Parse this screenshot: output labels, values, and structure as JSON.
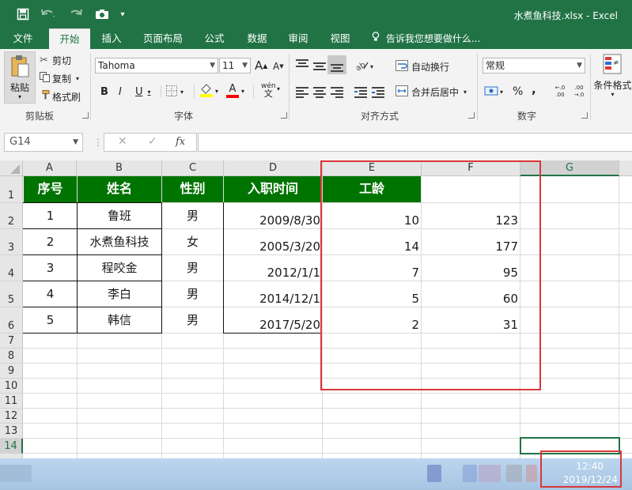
{
  "window": {
    "title": "水煮鱼科技.xlsx - Excel"
  },
  "tabs": [
    "文件",
    "开始",
    "插入",
    "页面布局",
    "公式",
    "数据",
    "审阅",
    "视图"
  ],
  "tell_me": "告诉我您想要做什么...",
  "ribbon": {
    "clipboard": {
      "paste": "粘贴",
      "cut": "剪切",
      "copy": "复制",
      "format_painter": "格式刷",
      "label": "剪贴板"
    },
    "font": {
      "name": "Tahoma",
      "size": "11",
      "bold": "B",
      "italic": "I",
      "underline": "U",
      "label": "字体",
      "grow": "A",
      "shrink": "A",
      "phonetic": "wén"
    },
    "alignment": {
      "wrap_text": "自动换行",
      "merge_center": "合并后居中",
      "label": "对齐方式"
    },
    "number": {
      "format": "常规",
      "percent": "%",
      "comma": ",",
      "inc_decimal": "←.0 .00",
      "dec_decimal": ".00 →.0",
      "label": "数字"
    },
    "styles": {
      "conditional_format": "条件格式"
    }
  },
  "formula_bar": {
    "name_box": "G14",
    "fx": "fx",
    "cancel": "✕",
    "enter": "✓",
    "value": ""
  },
  "grid": {
    "columns": [
      "A",
      "B",
      "C",
      "D",
      "E",
      "F",
      "G"
    ],
    "rows": [
      "1",
      "2",
      "3",
      "4",
      "5",
      "6",
      "7",
      "8",
      "9",
      "10",
      "11",
      "12",
      "13",
      "14"
    ],
    "header_row": [
      "序号",
      "姓名",
      "性别",
      "入职时间",
      "工龄"
    ],
    "data": [
      {
        "no": "1",
        "name": "鲁班",
        "gender": "男",
        "date": "2009/8/30",
        "years": "10",
        "f": "123"
      },
      {
        "no": "2",
        "name": "水煮鱼科技",
        "gender": "女",
        "date": "2005/3/20",
        "years": "14",
        "f": "177"
      },
      {
        "no": "3",
        "name": "程咬金",
        "gender": "男",
        "date": "2012/1/1",
        "years": "7",
        "f": "95"
      },
      {
        "no": "4",
        "name": "李白",
        "gender": "男",
        "date": "2014/12/1",
        "years": "5",
        "f": "60"
      },
      {
        "no": "5",
        "name": "韩信",
        "gender": "男",
        "date": "2017/5/20",
        "years": "2",
        "f": "31"
      }
    ],
    "header_fill": "#007400",
    "highlight_color": "#d9383a"
  },
  "taskbar": {
    "time": "12:40",
    "date": "2019/12/24"
  }
}
